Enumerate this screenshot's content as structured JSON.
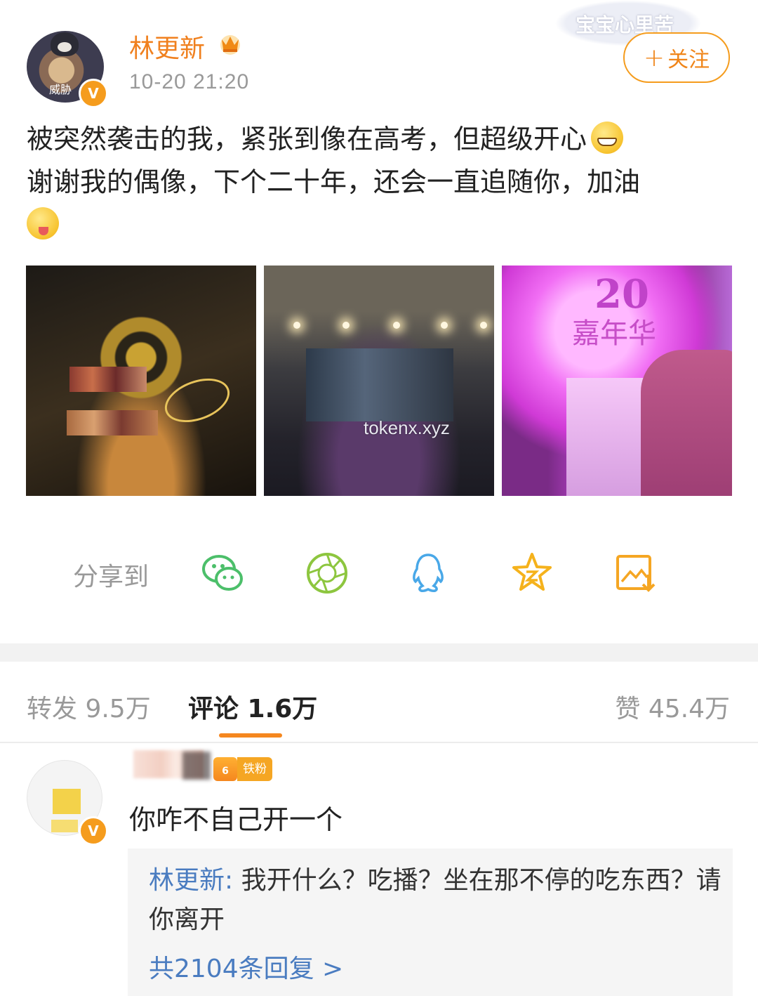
{
  "post": {
    "avatar_label": "威胁",
    "username": "林更新",
    "timestamp": "10-20 21:20",
    "follow_label": "关注",
    "sticker_text": "宝宝心里苦",
    "text_line1": "被突然袭击的我，紧张到像在高考，但超级开心",
    "text_line2": "谢谢我的偶像，下个二十年，还会一直追随你，加油",
    "emoji_grin": "grinning-emoji",
    "emoji_tongue": "tongue-out-emoji"
  },
  "images": {
    "image3_text_20": "20",
    "image3_text_jnh": "嘉年华",
    "watermark": "tokenx.xyz"
  },
  "share": {
    "label": "分享到",
    "icons": [
      "wechat-icon",
      "moments-icon",
      "qq-icon",
      "qzone-icon",
      "save-image-icon"
    ]
  },
  "tabs": {
    "repost": "转发 9.5万",
    "comment": "评论 1.6万",
    "like": "赞 45.4万"
  },
  "comment": {
    "fan_level": "6",
    "fan_badge": "铁粉",
    "text": "你咋不自己开一个",
    "reply_name": "林更新:",
    "reply_text": " 我开什么？吃播？坐在那不停的吃东西？请你离开",
    "reply_count": "共2104条回复 >"
  },
  "colors": {
    "accent": "#f5871f",
    "username": "#f0801e",
    "link": "#4a7cc0"
  }
}
